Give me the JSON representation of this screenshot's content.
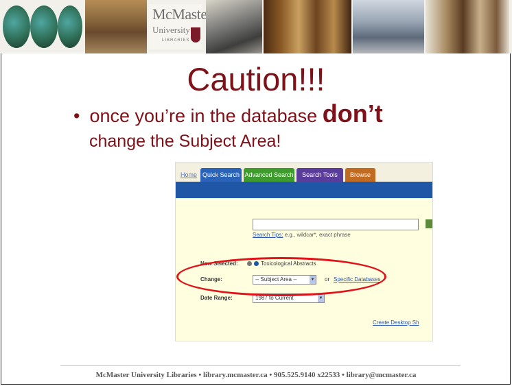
{
  "banner": {
    "logo_name": "McMaster",
    "logo_university": "University",
    "logo_libraries": "LIBRARIES"
  },
  "slide": {
    "title": "Caution!!!",
    "bullet_symbol": "•",
    "bullet_text": "once you’re in the database",
    "bullet_emphasis": "don’t",
    "bullet_line2": "change the Subject Area!"
  },
  "screenshot": {
    "tabs": [
      {
        "label": "Quick Search",
        "color": "#2a63b8"
      },
      {
        "label": "Advanced Search",
        "color": "#3f9b2d"
      },
      {
        "label": "Search Tools",
        "color": "#5a3d9a"
      },
      {
        "label": "Browse",
        "color": "#c06a22"
      }
    ],
    "first_tab_stub": "Home",
    "search_tips_link": "Search Tips:",
    "search_tips_text": "e.g., wildcar*, exact phrase",
    "now_selected_label": "Now Selected:",
    "now_selected_value": "Toxicological Abstracts",
    "change_label": "Change:",
    "subject_area_value": "-- Subject Area --",
    "or_text": "or",
    "specific_databases_link": "Specific Databases",
    "date_range_label": "Date Range:",
    "date_range_value": "1987 to Current",
    "create_alert_link": "Create Desktop Sh"
  },
  "footer": {
    "text": "McMaster University Libraries • library.mcmaster.ca • 905.525.9140 x22533 • library@mcmaster.ca"
  },
  "colors": {
    "title": "#7f1119",
    "annotation_oval": "#e0131b",
    "screenshot_bg": "#ffffe0",
    "blue_bar": "#1f56a6"
  }
}
